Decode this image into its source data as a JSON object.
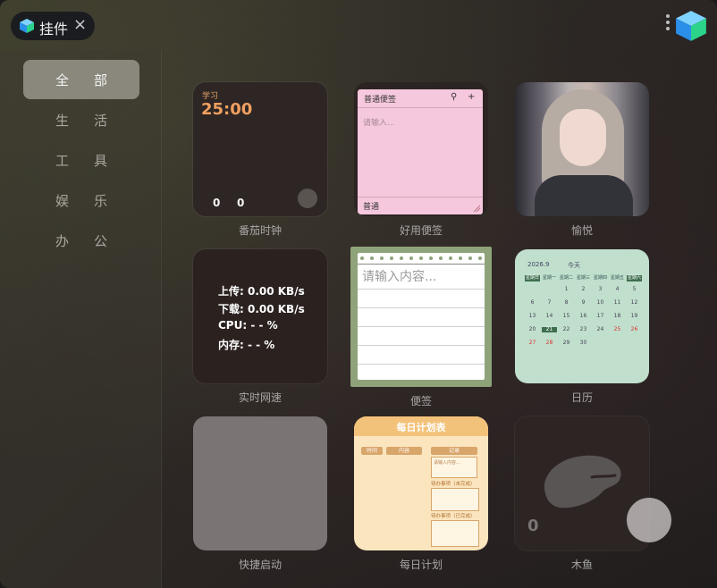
{
  "header": {
    "tab_title": "挂件",
    "close_icon": "close-icon",
    "menu_icon": "more-vertical-icon",
    "app_icon": "cube-icon"
  },
  "sidebar": {
    "items": [
      {
        "label": "全部",
        "active": true
      },
      {
        "label": "生活",
        "active": false
      },
      {
        "label": "工具",
        "active": false
      },
      {
        "label": "娱乐",
        "active": false
      },
      {
        "label": "办公",
        "active": false
      }
    ]
  },
  "widgets": {
    "pomodoro": {
      "tag": "学习",
      "time": "25:00",
      "count_a": "0",
      "count_b": "0",
      "label": "番茄时钟"
    },
    "sticky": {
      "header": "普通便签",
      "placeholder": "请输入...",
      "footer": "普通",
      "label": "好用便签"
    },
    "photo": {
      "label": "愉悦"
    },
    "netspeed": {
      "upload": "上传: 0.00 KB/s",
      "download": "下载: 0.00 KB/s",
      "cpu": "CPU:   - - %",
      "mem": "内存:   - - %",
      "label": "实时网速"
    },
    "notes": {
      "placeholder": "请输入内容...",
      "label": "便签"
    },
    "calendar": {
      "year_month": "2026.9",
      "today_btn": "今天",
      "weekdays": [
        "星期日",
        "星期一",
        "星期二",
        "星期三",
        "星期四",
        "星期五",
        "星期六"
      ],
      "label": "日历"
    },
    "quick": {
      "label": "快捷启动"
    },
    "plan": {
      "title": "每日计划表",
      "col_time": "时间",
      "col_content": "内容",
      "col_record": "记录",
      "record_placeholder": "请输入内容...",
      "todo_label": "待办事项（未完成）",
      "done_label": "待办事项（已完成）",
      "label": "每日计划"
    },
    "fish": {
      "count": "0",
      "label": "木鱼"
    }
  },
  "help": {
    "label": "?"
  },
  "colors": {
    "accent": "#f0a060",
    "sticky": "#f6c8dd",
    "calendar": "#c0dfcc",
    "plan": "#fbe5bf",
    "notes_frame": "#8fa37b"
  }
}
